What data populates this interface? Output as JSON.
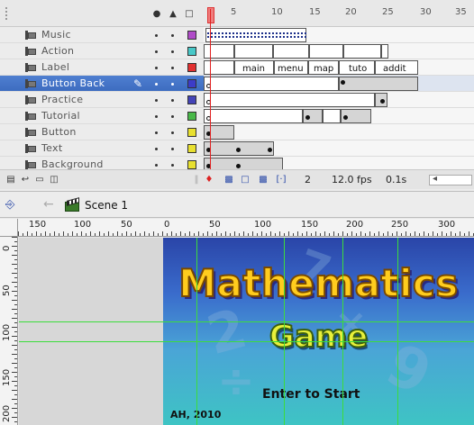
{
  "timeline": {
    "ruler_numbers": [
      "5",
      "10",
      "15",
      "20",
      "25",
      "30",
      "35"
    ],
    "header_icons": [
      "eye-icon",
      "lock-icon",
      "outline-icon"
    ],
    "layers": [
      {
        "name": "Music",
        "color": "#b04cc8",
        "selected": false
      },
      {
        "name": "Action",
        "color": "#48c8c8",
        "selected": false
      },
      {
        "name": "Label",
        "color": "#e23030",
        "selected": false
      },
      {
        "name": "Button Back",
        "color": "#3c3cc8",
        "selected": true
      },
      {
        "name": "Practice",
        "color": "#4444b8",
        "selected": false
      },
      {
        "name": "Tutorial",
        "color": "#48b848",
        "selected": false
      },
      {
        "name": "Button",
        "color": "#e8e030",
        "selected": false
      },
      {
        "name": "Text",
        "color": "#e8e030",
        "selected": false
      },
      {
        "name": "Background",
        "color": "#e8e030",
        "selected": false
      }
    ],
    "frame_labels": [
      "main",
      "menu",
      "map",
      "tuto",
      "addit"
    ],
    "footer": {
      "current_frame": "2",
      "frame_rate": "12.0 fps",
      "elapsed": "0.1s"
    }
  },
  "editbar": {
    "scene_label": "Scene 1"
  },
  "rulers": {
    "horizontal": [
      "150",
      "100",
      "50",
      "0",
      "50",
      "100",
      "150",
      "200",
      "250",
      "300"
    ],
    "vertical": [
      "0",
      "50",
      "100",
      "150",
      "200"
    ]
  },
  "stage": {
    "title_line1": "Mathematics",
    "title_line2": "Game",
    "enter_prompt": "Enter to Start",
    "credit": "AH, 2010",
    "colors": {
      "title1": "#ffcc1e",
      "title2": "#e8f03a",
      "guides": "#3cdc3c"
    }
  }
}
